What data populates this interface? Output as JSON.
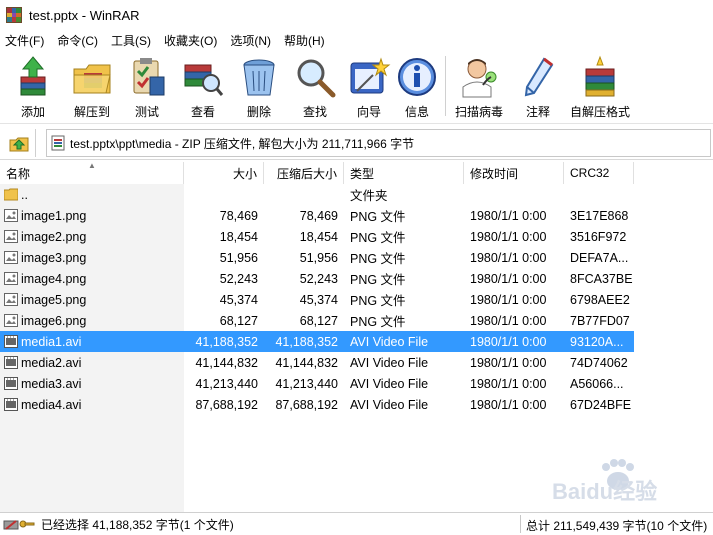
{
  "window": {
    "title": "test.pptx - WinRAR"
  },
  "menu": [
    "文件(F)",
    "命令(C)",
    "工具(S)",
    "收藏夹(O)",
    "选项(N)",
    "帮助(H)"
  ],
  "toolbar": [
    {
      "label": "添加",
      "icon": "add-books-icon"
    },
    {
      "label": "解压到",
      "icon": "extract-folder-icon"
    },
    {
      "label": "测试",
      "icon": "test-clipboard-icon"
    },
    {
      "label": "查看",
      "icon": "view-books-icon"
    },
    {
      "label": "删除",
      "icon": "delete-bin-icon"
    },
    {
      "label": "查找",
      "icon": "find-magnifier-icon"
    },
    {
      "label": "向导",
      "icon": "wizard-icon"
    },
    {
      "label": "信息",
      "icon": "info-icon"
    },
    {
      "label": "扫描病毒",
      "icon": "scan-virus-doctor-icon"
    },
    {
      "label": "注释",
      "icon": "comment-pen-icon"
    },
    {
      "label": "自解压格式",
      "icon": "sfx-books-icon"
    }
  ],
  "address": {
    "text": "test.pptx\\ppt\\media - ZIP 压缩文件, 解包大小为 211,711,966 字节"
  },
  "columns": {
    "name": "名称",
    "size": "大小",
    "packed": "压缩后大小",
    "type": "类型",
    "modified": "修改时间",
    "crc": "CRC32"
  },
  "rows": [
    {
      "name": "..",
      "size": "",
      "packed": "",
      "type": "文件夹",
      "modified": "",
      "crc": "",
      "kind": "folder"
    },
    {
      "name": "image1.png",
      "size": "78,469",
      "packed": "78,469",
      "type": "PNG 文件",
      "modified": "1980/1/1 0:00",
      "crc": "3E17E868",
      "kind": "png"
    },
    {
      "name": "image2.png",
      "size": "18,454",
      "packed": "18,454",
      "type": "PNG 文件",
      "modified": "1980/1/1 0:00",
      "crc": "3516F972",
      "kind": "png"
    },
    {
      "name": "image3.png",
      "size": "51,956",
      "packed": "51,956",
      "type": "PNG 文件",
      "modified": "1980/1/1 0:00",
      "crc": "DEFA7A...",
      "kind": "png"
    },
    {
      "name": "image4.png",
      "size": "52,243",
      "packed": "52,243",
      "type": "PNG 文件",
      "modified": "1980/1/1 0:00",
      "crc": "8FCA37BE",
      "kind": "png"
    },
    {
      "name": "image5.png",
      "size": "45,374",
      "packed": "45,374",
      "type": "PNG 文件",
      "modified": "1980/1/1 0:00",
      "crc": "6798AEE2",
      "kind": "png"
    },
    {
      "name": "image6.png",
      "size": "68,127",
      "packed": "68,127",
      "type": "PNG 文件",
      "modified": "1980/1/1 0:00",
      "crc": "7B77FD07",
      "kind": "png"
    },
    {
      "name": "media1.avi",
      "size": "41,188,352",
      "packed": "41,188,352",
      "type": "AVI Video File",
      "modified": "1980/1/1 0:00",
      "crc": "93120A...",
      "kind": "avi",
      "selected": true
    },
    {
      "name": "media2.avi",
      "size": "41,144,832",
      "packed": "41,144,832",
      "type": "AVI Video File",
      "modified": "1980/1/1 0:00",
      "crc": "74D74062",
      "kind": "avi"
    },
    {
      "name": "media3.avi",
      "size": "41,213,440",
      "packed": "41,213,440",
      "type": "AVI Video File",
      "modified": "1980/1/1 0:00",
      "crc": "A56066...",
      "kind": "avi"
    },
    {
      "name": "media4.avi",
      "size": "87,688,192",
      "packed": "87,688,192",
      "type": "AVI Video File",
      "modified": "1980/1/1 0:00",
      "crc": "67D24BFE",
      "kind": "avi"
    }
  ],
  "status": {
    "selected": "已经选择 41,188,352 字节(1 个文件)",
    "total": "总计 211,549,439 字节(10 个文件)"
  },
  "watermark": {
    "text": "Baidu经验"
  }
}
